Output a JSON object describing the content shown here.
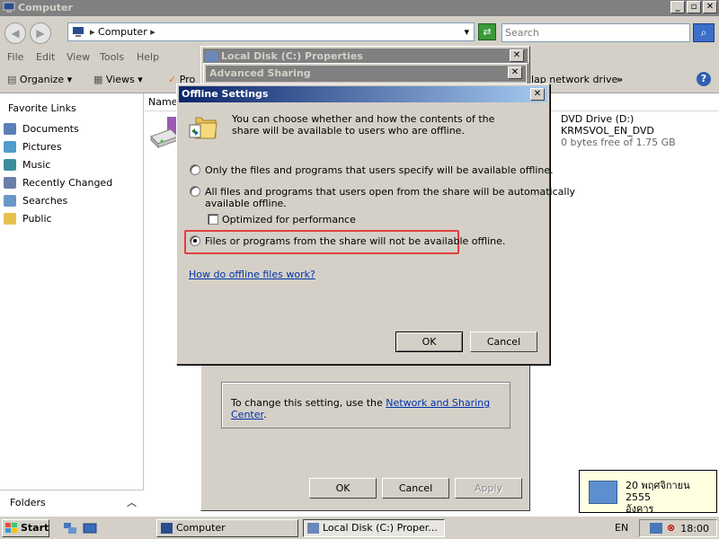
{
  "explorer": {
    "title": "Computer",
    "address": "Computer",
    "search_placeholder": "Search",
    "menu": [
      "File",
      "Edit",
      "View",
      "Tools",
      "Help"
    ],
    "toolbar": {
      "organize": "Organize",
      "views": "Views",
      "properties_partial": "Pro",
      "map_drive_partial": "lap network drive",
      "overflow": "»"
    },
    "nav": {
      "title": "Favorite Links",
      "items": [
        "Documents",
        "Pictures",
        "Music",
        "Recently Changed",
        "Searches",
        "Public"
      ],
      "folders": "Folders"
    },
    "column_header": "Name",
    "dvd": {
      "name": "DVD Drive (D:)",
      "label": "KRMSVOL_EN_DVD",
      "free": "0 bytes free of 1.75 GB"
    }
  },
  "properties": {
    "title": "Local Disk (C:) Properties",
    "info_text": "To change this setting, use the ",
    "info_link": "Network and Sharing Center",
    "info_suffix": ".",
    "ok": "OK",
    "cancel": "Cancel",
    "apply": "Apply"
  },
  "advanced_sharing": {
    "title": "Advanced Sharing"
  },
  "offline": {
    "title": "Offline Settings",
    "close": "✕",
    "description": "You can choose whether and how the contents of the share will be available to users who are offline.",
    "option1": "Only the files and programs that users specify will be available offline.",
    "option2_line1": "All files and programs that users open from the share will be automatically",
    "option2_line2": "available offline.",
    "optimize": "Optimized for performance",
    "option3": "Files or programs from the share will not be available offline.",
    "selected_option": 3,
    "help_link": "How do offline files work?",
    "ok": "OK",
    "cancel": "Cancel"
  },
  "notification": {
    "line1": "20 พฤศจิกายน 2555",
    "line2": "อังคาร"
  },
  "taskbar": {
    "start": "Start",
    "tasks": [
      "Computer",
      "Local Disk (C:) Proper..."
    ],
    "language": "EN",
    "clock": "18:00"
  },
  "colors": {
    "active_title_start": "#0a246a",
    "active_title_end": "#a6caf0",
    "inactive_title": "#808080",
    "highlight_border": "#e04040",
    "link": "#0033aa"
  }
}
